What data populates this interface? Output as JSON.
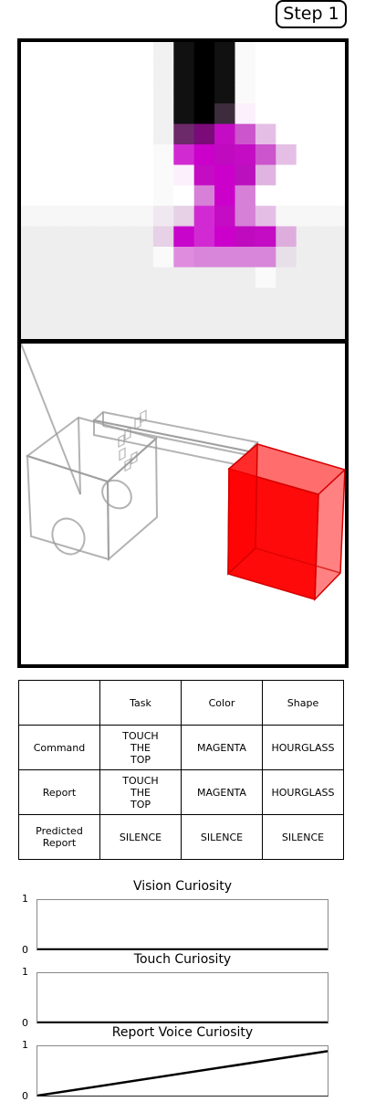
{
  "step_label": "Step 1",
  "vision_pixels": {
    "colors": {
      "0": "#eeeeee",
      "1": "#fcfcfc",
      "2": "#f8f8f8",
      "3": "#f1f1f1",
      "4": "#111111",
      "5": "#000000",
      "6": "#1b1b1b",
      "7": "#3d2c3c",
      "8": "#6c2a6a",
      "9": "#7a0b79",
      "a": "#c00ac0",
      "b": "#c40cc4",
      "c": "#cc54cc",
      "d": "#e5bee5",
      "e": "#b100b3",
      "f": "#d12ad3",
      "g": "#fbf0fb",
      "h": "#ca5fcb",
      "i": "#cb00cb",
      "j": "#d680d7",
      "k": "#dfb4e0",
      "l": "#f0e8f0",
      "m": "#e6d1e6",
      "n": "#bb10bd",
      "o": "#c805ca",
      "p": "#ddaedd",
      "q": "#df8cdf",
      "r": "#d786d9",
      "s": "#e8e0e8",
      "t": "#f7f7f7",
      "u": "#fafafa",
      "w": "#ffffff"
    },
    "rows": [
      "wwwwwww3454uwwwww",
      "wwwwwww3454uwwwww",
      "wwwwwww3454uwwwww",
      "wwwwwww3457gwwwww",
      "wwwwwww389bcdwwww",
      "wwwwwwwufiabcdwww",
      "wwwwwwwugbinkwwww",
      "wwwwwwwuwjijwwwww",
      "tttttttlmfbjdtttt",
      "0000000mofiabp000",
      "0000000uqrrrrs000",
      "000000000000u0000",
      "00000000000000000",
      "00000000000000000",
      "00000000000000000"
    ]
  },
  "table": {
    "headers": [
      "",
      "Task",
      "Color",
      "Shape"
    ],
    "rows": [
      [
        "Command",
        "TOUCH\nTHE\nTOP",
        "MAGENTA",
        "HOURGLASS"
      ],
      [
        "Report",
        "TOUCH\nTHE\nTOP",
        "MAGENTA",
        "HOURGLASS"
      ],
      [
        "Predicted\nReport",
        "SILENCE",
        "SILENCE",
        "SILENCE"
      ]
    ]
  },
  "charts": [
    {
      "title": "Vision Curiosity",
      "y_max_label": "1",
      "y_min_label": "0",
      "ylim": [
        0,
        1
      ],
      "line": [
        [
          0,
          0
        ],
        [
          1,
          0
        ]
      ]
    },
    {
      "title": "Touch Curiosity",
      "y_max_label": "1",
      "y_min_label": "0",
      "ylim": [
        0,
        1
      ],
      "line": [
        [
          0,
          0
        ],
        [
          1,
          0
        ]
      ]
    },
    {
      "title": "Report Voice Curiosity",
      "y_max_label": "1",
      "y_min_label": "0",
      "ylim": [
        0,
        1
      ],
      "line": [
        [
          0,
          0
        ],
        [
          1,
          0.9
        ]
      ]
    }
  ],
  "colors": {
    "accent": "#ff0000",
    "magenta": "#cc00cc"
  }
}
